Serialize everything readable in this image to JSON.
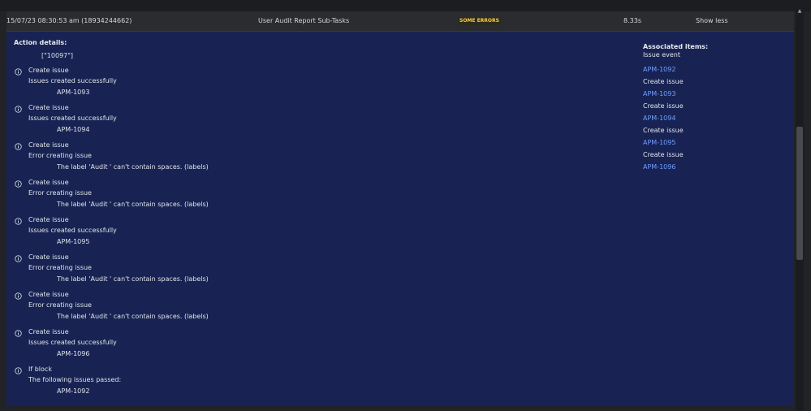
{
  "header": {
    "timestamp": "15/07/23 08:30:53 am (18934244662)",
    "rule_name": "User Audit Report Sub-Tasks",
    "status_badge": "SOME ERRORS",
    "duration": "8.33s",
    "toggle_label": "Show less"
  },
  "details": {
    "title": "Action details:",
    "value": "[\"10097\"]",
    "entries": [
      {
        "title": "Create issue",
        "status": "Issues created successfully",
        "detail": "APM-1093"
      },
      {
        "title": "Create issue",
        "status": "Issues created successfully",
        "detail": "APM-1094"
      },
      {
        "title": "Create issue",
        "status": "Error creating issue",
        "detail": "The label 'Audit ' can't contain spaces. (labels)"
      },
      {
        "title": "Create issue",
        "status": "Error creating issue",
        "detail": "The label 'Audit ' can't contain spaces. (labels)"
      },
      {
        "title": "Create issue",
        "status": "Issues created successfully",
        "detail": "APM-1095"
      },
      {
        "title": "Create issue",
        "status": "Error creating issue",
        "detail": "The label 'Audit ' can't contain spaces. (labels)"
      },
      {
        "title": "Create issue",
        "status": "Error creating issue",
        "detail": "The label 'Audit ' can't contain spaces. (labels)"
      },
      {
        "title": "Create issue",
        "status": "Issues created successfully",
        "detail": "APM-1096"
      },
      {
        "title": "If block",
        "status": "The following issues passed:",
        "detail": "APM-1092"
      }
    ]
  },
  "associated": {
    "title": "Associated items:",
    "items": [
      {
        "text": "Issue event",
        "link": false
      },
      {
        "text": "APM-1092",
        "link": true
      },
      {
        "text": "Create issue",
        "link": false
      },
      {
        "text": "APM-1093",
        "link": true
      },
      {
        "text": "Create issue",
        "link": false
      },
      {
        "text": "APM-1094",
        "link": true
      },
      {
        "text": "Create issue",
        "link": false
      },
      {
        "text": "APM-1095",
        "link": true
      },
      {
        "text": "Create issue",
        "link": false
      },
      {
        "text": "APM-1096",
        "link": true
      }
    ]
  },
  "colors": {
    "panel_bg": "#182353",
    "header_bg": "#2b2c30",
    "badge_text": "#f4d03f",
    "link": "#6f9dff"
  },
  "icons": {
    "entry_icon": "info-circle-icon",
    "scroll_up": "chevron-up-icon"
  }
}
